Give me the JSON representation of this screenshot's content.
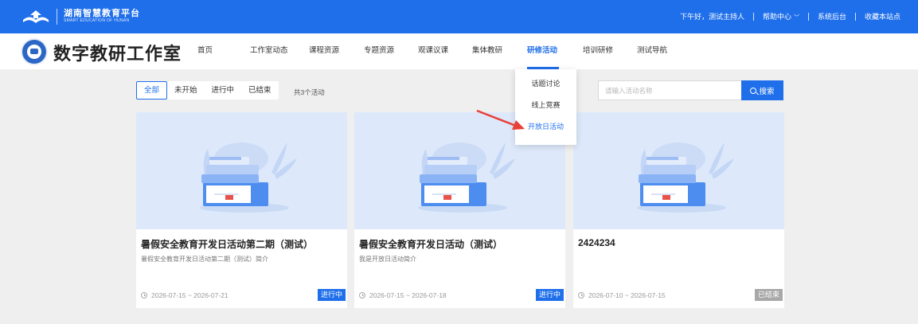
{
  "topbar": {
    "brand_cn": "湖南智慧教育平台",
    "brand_en": "SMART EDUCATION OF HUNAN",
    "greeting": "下午好，测试主持人",
    "help": "帮助中心",
    "admin": "系统后台",
    "bookmark": "收藏本站点"
  },
  "header": {
    "site_title": "数字教研工作室",
    "nav": [
      "首页",
      "工作室动态",
      "课程资源",
      "专题资源",
      "观课议课",
      "集体教研",
      "研修活动",
      "培训研修",
      "测试导航"
    ],
    "active_nav": "研修活动"
  },
  "filters": {
    "tabs": [
      "全部",
      "未开始",
      "进行中",
      "已结束"
    ],
    "active_tab": "全部",
    "count_text": "共3个活动"
  },
  "search": {
    "placeholder": "请输入活动名称",
    "button_label": "搜索"
  },
  "dropdown": {
    "items": [
      "话题讨论",
      "线上竞赛",
      "开放日活动"
    ],
    "highlighted": "开放日活动"
  },
  "cards": [
    {
      "title": "暑假安全教育开发日活动第二期（测试）",
      "desc": "暑假安全教育开发日活动第二期（测试）简介",
      "date": "2026-07-15 ~ 2026-07-21",
      "status": "进行中"
    },
    {
      "title": "暑假安全教育开发日活动（测试）",
      "desc": "我是开放日活动简介",
      "date": "2026-07-15 ~ 2026-07-18",
      "status": "进行中"
    },
    {
      "title": "2424234",
      "desc": "",
      "date": "2026-07-10 ~ 2026-07-15",
      "status": "已结束"
    }
  ],
  "colors": {
    "primary": "#1f6feb",
    "ended_badge": "#a8a8a8",
    "cover_bg": "#dde9fb",
    "annotation_arrow": "#e8413a"
  }
}
